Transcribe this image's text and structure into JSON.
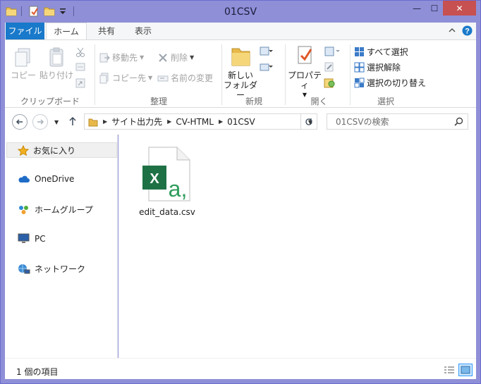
{
  "window": {
    "title": "01CSV",
    "minimize": "—",
    "maximize": "☐",
    "close": "✕"
  },
  "ribbon_tabs": {
    "file": "ファイル",
    "home": "ホーム",
    "share": "共有",
    "view": "表示"
  },
  "ribbon": {
    "clipboard": {
      "copy": "コピー",
      "paste": "貼り付け",
      "label": "クリップボード"
    },
    "organize": {
      "move_to": "移動先",
      "copy_to": "コピー先",
      "delete": "削除",
      "rename": "名前の変更",
      "label": "整理"
    },
    "new": {
      "new_folder_line1": "新しい",
      "new_folder_line2": "フォルダー",
      "label": "新規"
    },
    "open": {
      "properties": "プロパティ",
      "label": "開く"
    },
    "select": {
      "select_all": "すべて選択",
      "select_none": "選択解除",
      "invert_selection": "選択の切り替え",
      "label": "選択"
    }
  },
  "address": {
    "breadcrumbs": [
      "サイト出力先",
      "CV-HTML",
      "01CSV"
    ],
    "search_placeholder": "01CSVの検索"
  },
  "nav_pane": {
    "favorites": "お気に入り",
    "onedrive": "OneDrive",
    "homegroup": "ホームグループ",
    "pc": "PC",
    "network": "ネットワーク"
  },
  "files": [
    {
      "name": "edit_data.csv",
      "icon": "excel-csv-file-icon"
    }
  ],
  "status": {
    "item_count": "1 個の項目"
  },
  "colors": {
    "title_bar": "#8e8fd7",
    "file_tab": "#1979ca",
    "excel_green": "#1e7145",
    "folder_yellow": "#e8b84a"
  }
}
